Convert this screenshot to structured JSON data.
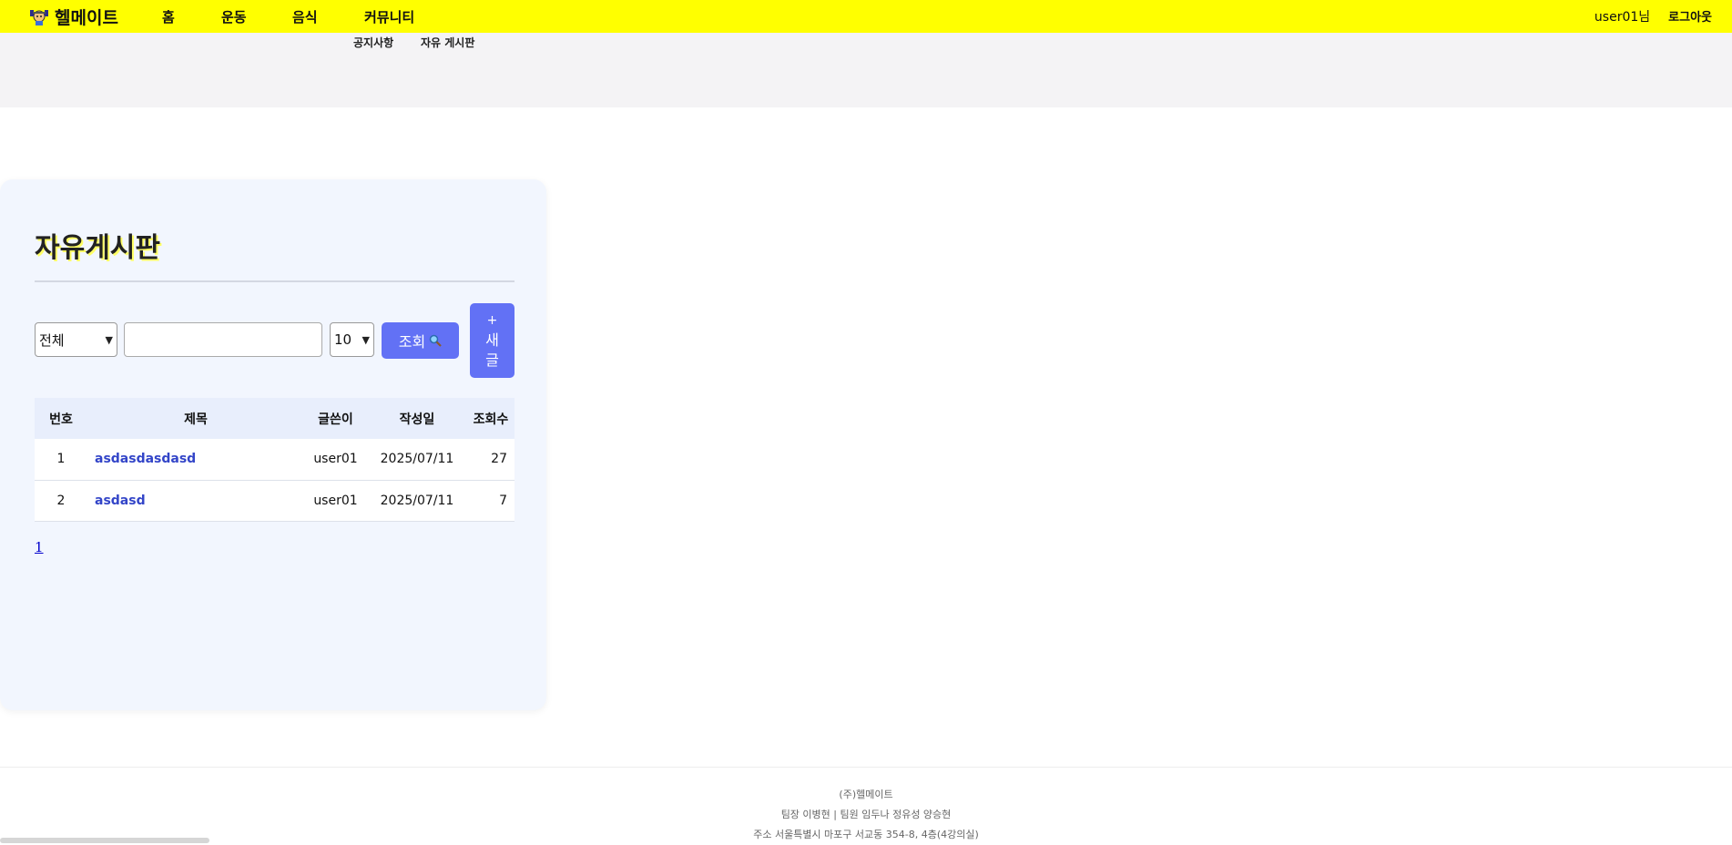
{
  "header": {
    "logo_text": "헬메이트",
    "nav": [
      {
        "label": "홈"
      },
      {
        "label": "운동"
      },
      {
        "label": "음식"
      },
      {
        "label": "커뮤니티"
      }
    ],
    "user_label": "user01님",
    "logout_label": "로그아웃",
    "accent_color": "#ffff00"
  },
  "submenu": {
    "items": [
      {
        "label": "공지사항"
      },
      {
        "label": "자유 게시판"
      }
    ]
  },
  "board": {
    "title": "자유게시판",
    "search": {
      "category_value": "전체",
      "query_value": "",
      "page_size_value": "10",
      "search_button_label": "조회",
      "new_button_plus": "+",
      "new_button_line1": "새",
      "new_button_line2": "글"
    },
    "columns": [
      "번호",
      "제목",
      "글쓴이",
      "작성일",
      "조회수"
    ],
    "rows": [
      {
        "no": "1",
        "title": "asdasdasdasd",
        "author": "user01",
        "date": "2025/07/11",
        "views": "27"
      },
      {
        "no": "2",
        "title": "asdasd",
        "author": "user01",
        "date": "2025/07/11",
        "views": "7"
      }
    ],
    "pagination": {
      "current_page": "1"
    },
    "button_color": "#6271f5",
    "link_color": "#3345c8"
  },
  "footer": {
    "company": "(주)헬메이트",
    "team": "팀장 이병현 | 팀원 임두나 정유성 양승현",
    "address": "주소 서울특별시 마포구 서교동 354-8, 4층(4강의실)"
  }
}
